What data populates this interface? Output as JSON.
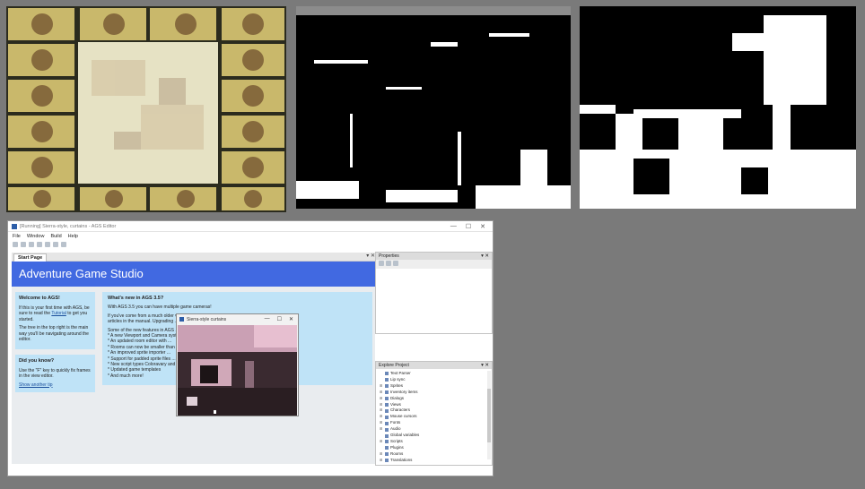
{
  "editor": {
    "title": "[Running] Sierra-style, curtains - AGS Editor",
    "window_controls": [
      "—",
      "☐",
      "✕"
    ],
    "menu": [
      "File",
      "Window",
      "Build",
      "Help"
    ],
    "tab_label": "Start Page",
    "tab_controls": "▾ ✕",
    "banner_title": "Adventure Game Studio",
    "welcome": {
      "heading": "Welcome to AGS!",
      "p1_before": "If this is your first time with AGS, be sure to read the",
      "p1_link": "Tutorial",
      "p1_after": "to get you started.",
      "p2": "The tree in the top right is the main way you'll be navigating around the editor."
    },
    "didyouknow": {
      "heading": "Did you know?",
      "text": "Use the \"F\" key to quickly fix frames in the view editor.",
      "link": "Show another tip"
    },
    "news": {
      "heading": "What's new in AGS 3.5?",
      "line1": "With AGS 3.5 you can have multiple game cameras!",
      "line2": "If you've come from a much older version of AGS, be sure to read \"Upgrading to ...\"",
      "line3": "articles in the manual. Upgrading ... current version.",
      "line4": "Some of the new features in AGS ...",
      "bullets": [
        "* A new Viewport and Camera system ... room",
        "* An updated room editor with ...",
        "* Rooms can now be smaller than ...",
        "* An improved sprite importer ...",
        "* Support for padded sprite files ...",
        "* New script types Coloravary and ...",
        "* Updated game templates",
        "* And much more!"
      ]
    },
    "properties": {
      "title": "Properties",
      "controls": "▾ ✕"
    },
    "explore": {
      "title": "Explore Project",
      "controls": "▾ ✕",
      "items": [
        "Text Parser",
        "Lip sync",
        "Sprites",
        "Inventory items",
        "Dialogs",
        "Views",
        "Characters",
        "Mouse cursors",
        "Fonts",
        "Audio",
        "Global variables",
        "Scripts",
        "Plugins",
        "Rooms",
        "Translations"
      ]
    }
  },
  "game": {
    "title": "Sierra-style curtains",
    "controls": [
      "—",
      "☐",
      "✕"
    ]
  },
  "colors": {
    "desktop": "#7a7a7a",
    "banner": "#4169e1",
    "infobox": "#bfe3f7"
  }
}
